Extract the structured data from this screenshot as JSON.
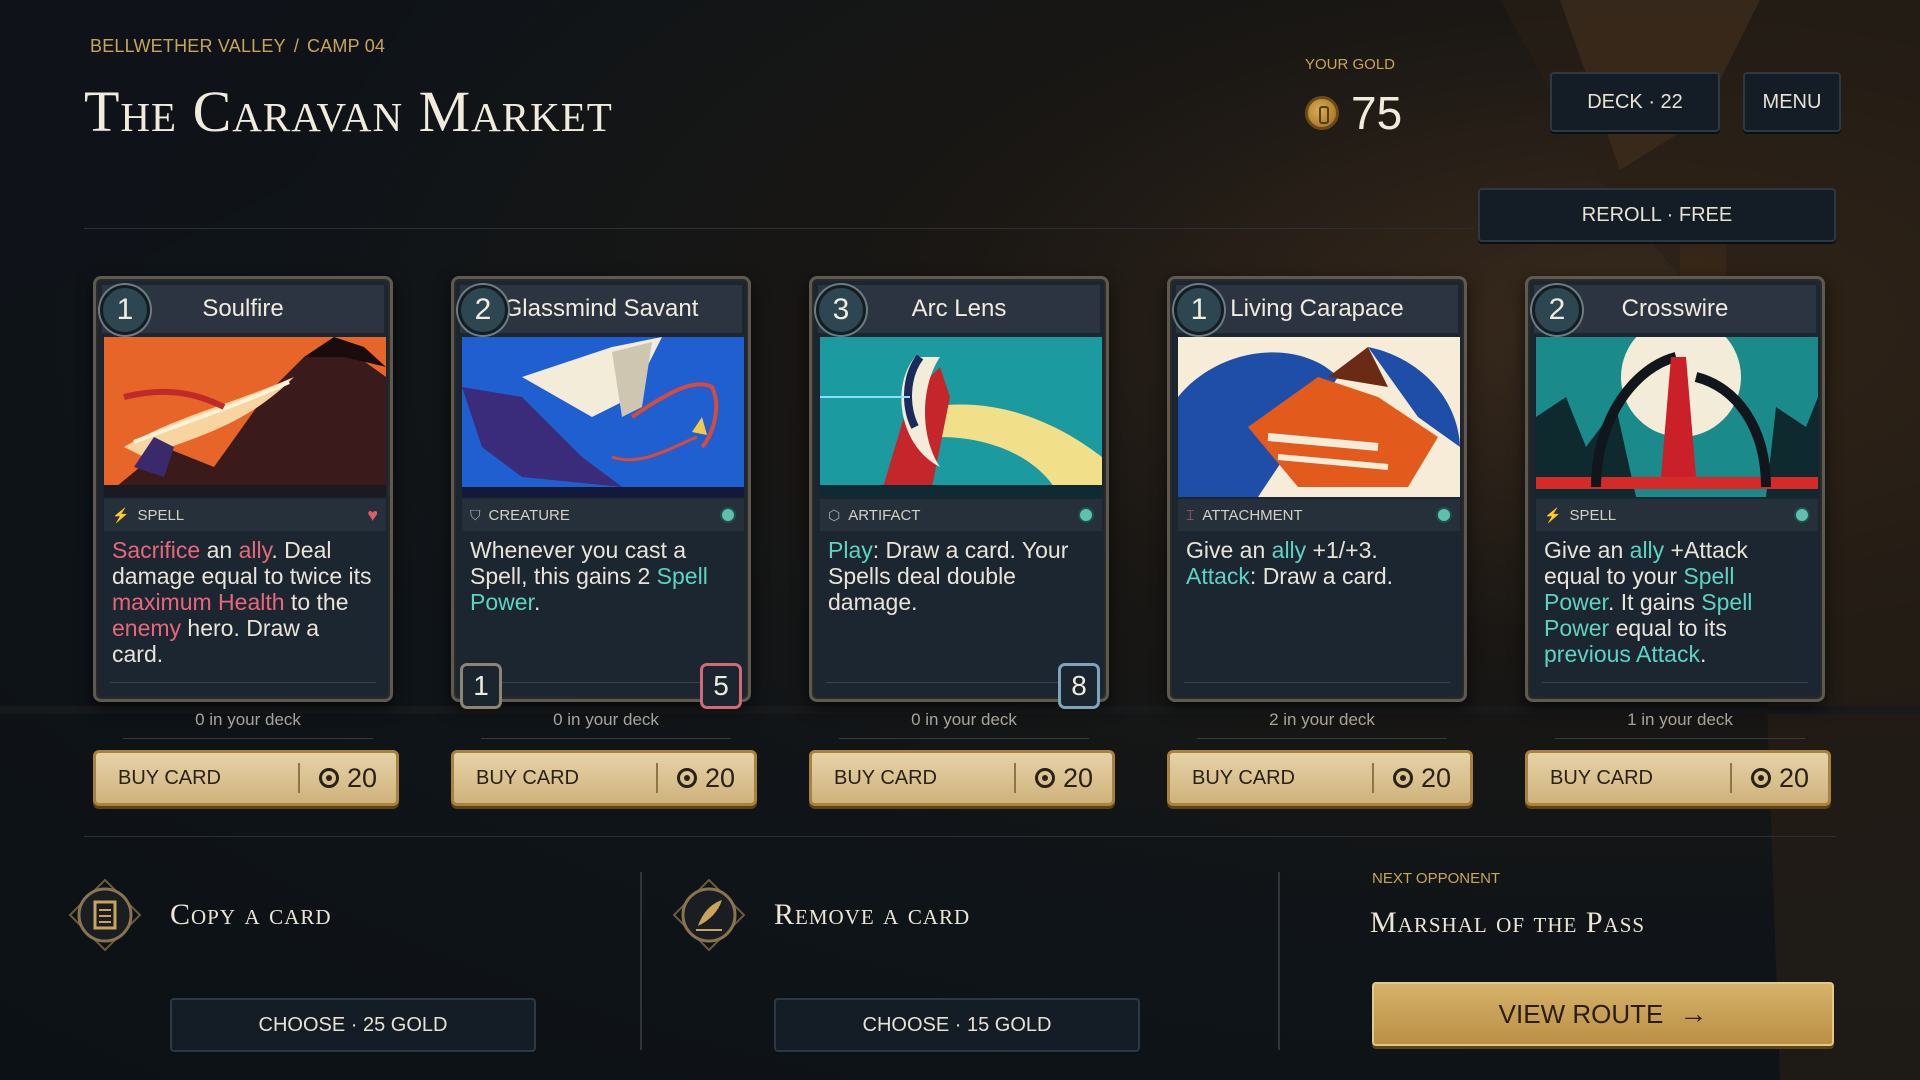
{
  "header": {
    "breadcrumb": [
      "BELLWETHER VALLEY",
      "/",
      "CAMP 04"
    ],
    "title": "The Caravan Market",
    "gold_label": "YOUR GOLD",
    "gold_value": "75",
    "deck_button": "DECK · 22",
    "menu_button": "MENU",
    "reroll_button": "REROLL · FREE"
  },
  "colors": {
    "accent_gold": "#c9a55c",
    "keyword_red": "#e8677b",
    "keyword_teal": "#5ed3c2"
  },
  "cards": [
    {
      "cost": "1",
      "name": "Soulfire",
      "type": "SPELL",
      "type_icon": "bolt-icon",
      "text_parts": [
        {
          "t": "Sacrifice",
          "c": "red"
        },
        {
          "t": " an ",
          "c": ""
        },
        {
          "t": "ally",
          "c": "red"
        },
        {
          "t": ". Deal damage equal to twice its ",
          "c": ""
        },
        {
          "t": "maximum Health",
          "c": "red"
        },
        {
          "t": " to the ",
          "c": ""
        },
        {
          "t": "enemy",
          "c": "red"
        },
        {
          "t": " hero. Draw a card.",
          "c": ""
        }
      ],
      "deck_count": "0 in your deck",
      "buy_label": "BUY CARD",
      "price": "20"
    },
    {
      "cost": "2",
      "name": "Glassmind Savant",
      "type": "CREATURE",
      "type_icon": "shield-icon",
      "text_parts": [
        {
          "t": "Whenever you cast a Spell, this gains 2 ",
          "c": ""
        },
        {
          "t": "Spell Power",
          "c": "teal"
        },
        {
          "t": ".",
          "c": ""
        }
      ],
      "attack": "1",
      "health": "5",
      "deck_count": "0 in your deck",
      "buy_label": "BUY CARD",
      "price": "20"
    },
    {
      "cost": "3",
      "name": "Arc Lens",
      "type": "ARTIFACT",
      "type_icon": "hexagon-icon",
      "text_parts": [
        {
          "t": "Play",
          "c": "teal"
        },
        {
          "t": ": Draw a card. Your Spells deal double damage.",
          "c": ""
        }
      ],
      "durability": "8",
      "deck_count": "0 in your deck",
      "buy_label": "BUY CARD",
      "price": "20"
    },
    {
      "cost": "1",
      "name": "Living Carapace",
      "type": "ATTACHMENT",
      "type_icon": "attachment-icon",
      "text_parts": [
        {
          "t": "Give an ",
          "c": ""
        },
        {
          "t": "ally",
          "c": "teal"
        },
        {
          "t": " +1/+3. ",
          "c": ""
        },
        {
          "t": "Attack",
          "c": "teal"
        },
        {
          "t": ": Draw a card.",
          "c": ""
        }
      ],
      "deck_count": "2 in your deck",
      "buy_label": "BUY CARD",
      "price": "20"
    },
    {
      "cost": "2",
      "name": "Crosswire",
      "type": "SPELL",
      "type_icon": "bolt-icon",
      "text_parts": [
        {
          "t": "Give an ",
          "c": ""
        },
        {
          "t": "ally",
          "c": "teal"
        },
        {
          "t": " +Attack equal to your ",
          "c": ""
        },
        {
          "t": "Spell Power",
          "c": "teal"
        },
        {
          "t": ". It gains ",
          "c": ""
        },
        {
          "t": "Spell Power",
          "c": "teal"
        },
        {
          "t": " equal to its ",
          "c": ""
        },
        {
          "t": "previous Attack",
          "c": "teal"
        },
        {
          "t": ".",
          "c": ""
        }
      ],
      "deck_count": "1 in your deck",
      "buy_label": "BUY CARD",
      "price": "20"
    }
  ],
  "services": {
    "copy_title": "Copy a card",
    "copy_button": "CHOOSE · 25 GOLD",
    "remove_title": "Remove a card",
    "remove_button": "CHOOSE · 15 GOLD"
  },
  "opponent": {
    "label": "NEXT OPPONENT",
    "name": "Marshal of the Pass",
    "route_button": "VIEW ROUTE"
  }
}
